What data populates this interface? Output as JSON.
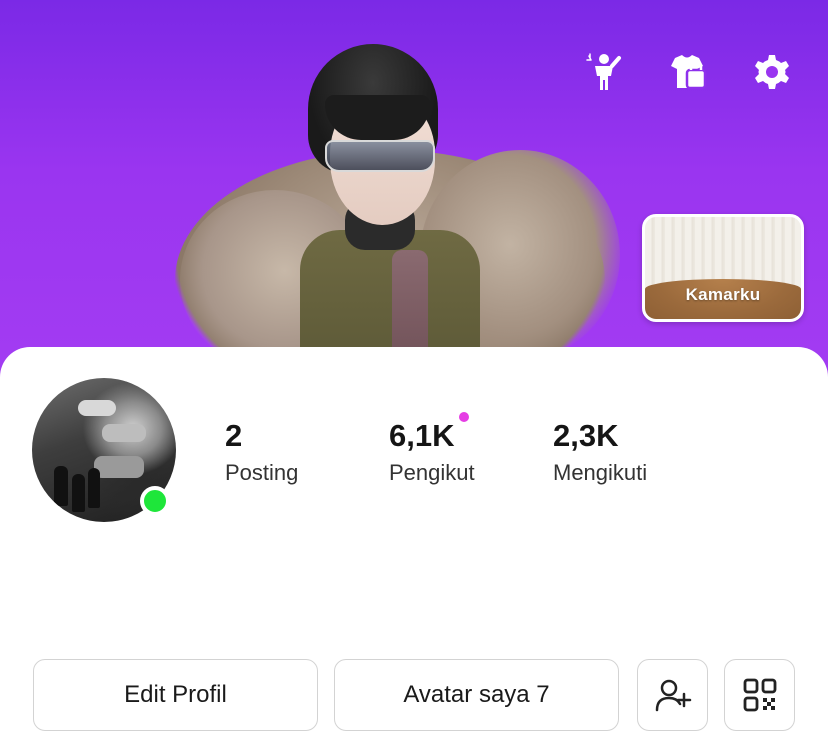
{
  "header": {
    "top_icons": [
      {
        "name": "avatar-pose-icon"
      },
      {
        "name": "outfit-shop-icon"
      },
      {
        "name": "settings-gear-icon"
      }
    ],
    "room_card": {
      "label": "Kamarku"
    }
  },
  "profile": {
    "online": true,
    "stats": [
      {
        "value": "2",
        "label": "Posting"
      },
      {
        "value": "6,1K",
        "label": "Pengikut",
        "has_notification_dot": true
      },
      {
        "value": "2,3K",
        "label": "Mengikuti"
      }
    ]
  },
  "actions": {
    "edit_profile": "Edit Profil",
    "my_avatar": "Avatar saya 7",
    "add_friend_icon": "add-person-icon",
    "qr_icon": "qr-code-icon"
  },
  "colors": {
    "header_gradient_top": "#7b29e6",
    "header_gradient_bottom": "#a33cf2",
    "online_green": "#1ee63a",
    "notification_pink": "#e53de4"
  }
}
